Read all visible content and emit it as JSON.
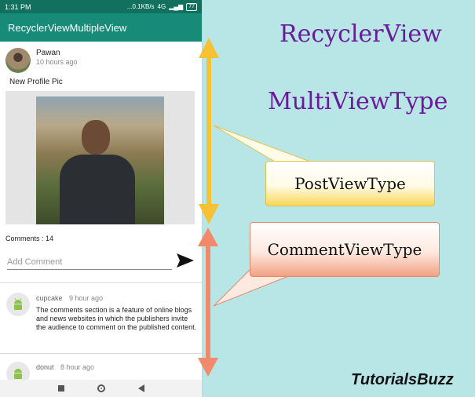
{
  "status_bar": {
    "time": "1:31 PM",
    "network": "...0.1KB/s",
    "signal": "4G",
    "battery": "77"
  },
  "app_bar": {
    "title": "RecyclerViewMultipleView"
  },
  "post": {
    "user": "Pawan",
    "time": "10 hours ago",
    "caption": "New Profile Pic",
    "comments_count": "Comments : 14",
    "add_comment_placeholder": "Add Comment"
  },
  "comments": [
    {
      "user": "cupcake",
      "time": "9 hour ago",
      "text": "The comments section is a feature of online blogs and news websites in which the publishers invite the audience to comment on the published content.",
      "avatar_icon": "android-icon"
    },
    {
      "user": "donut",
      "time": "8 hour ago",
      "avatar_icon": "android-icon"
    }
  ],
  "annotations": {
    "title_line1": "RecyclerView",
    "title_line2": "MultiViewType",
    "post_view_type": "PostViewType",
    "comment_view_type": "CommentViewType",
    "brand": "TutorialsBuzz"
  },
  "colors": {
    "app_bar": "#188a78",
    "status_bar": "#12705f",
    "background": "#b8e6e6",
    "title_text": "#6a1b9a",
    "post_arrow": "#f6c233",
    "comment_arrow": "#f08a6a",
    "android_green": "#8bc34a"
  }
}
